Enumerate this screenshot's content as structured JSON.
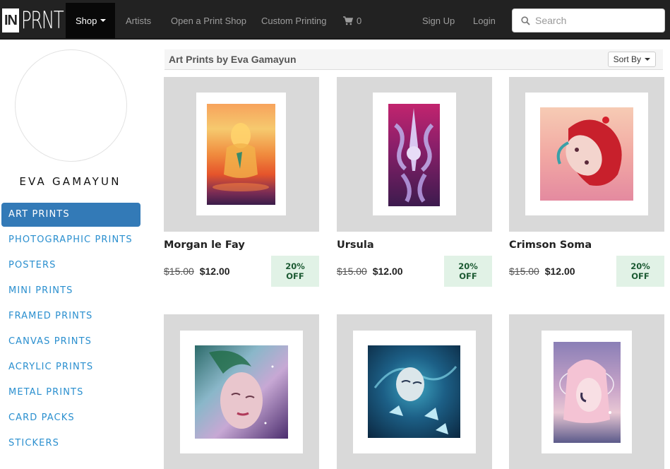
{
  "nav": {
    "logo_in": "IN",
    "logo_prnt": "PRNT",
    "shop": "Shop",
    "artists": "Artists",
    "open_shop": "Open a Print Shop",
    "custom_printing": "Custom Printing",
    "cart_count": "0",
    "sign_up": "Sign Up",
    "login": "Login",
    "search_placeholder": "Search"
  },
  "sidebar": {
    "artist_name": "EVA GAMAYUN",
    "categories": [
      {
        "label": "ART PRINTS",
        "active": true
      },
      {
        "label": "PHOTOGRAPHIC PRINTS",
        "active": false
      },
      {
        "label": "POSTERS",
        "active": false
      },
      {
        "label": "MINI PRINTS",
        "active": false
      },
      {
        "label": "FRAMED PRINTS",
        "active": false
      },
      {
        "label": "CANVAS PRINTS",
        "active": false
      },
      {
        "label": "ACRYLIC PRINTS",
        "active": false
      },
      {
        "label": "METAL PRINTS",
        "active": false
      },
      {
        "label": "CARD PACKS",
        "active": false
      },
      {
        "label": "STICKERS",
        "active": false
      }
    ]
  },
  "main": {
    "heading": "Art Prints by Eva Gamayun",
    "sort_label": "Sort By",
    "products": [
      {
        "title": "Morgan le Fay",
        "old_price": "$15.00",
        "price": "$12.00",
        "badge_line1": "20%",
        "badge_line2": "OFF"
      },
      {
        "title": "Ursula",
        "old_price": "$15.00",
        "price": "$12.00",
        "badge_line1": "20%",
        "badge_line2": "OFF"
      },
      {
        "title": "Crimson Soma",
        "old_price": "$15.00",
        "price": "$12.00",
        "badge_line1": "20%",
        "badge_line2": "OFF"
      },
      {
        "title": "",
        "old_price": "",
        "price": "",
        "badge_line1": "",
        "badge_line2": ""
      },
      {
        "title": "",
        "old_price": "",
        "price": "",
        "badge_line1": "",
        "badge_line2": ""
      },
      {
        "title": "",
        "old_price": "",
        "price": "",
        "badge_line1": "",
        "badge_line2": ""
      }
    ]
  },
  "colors": {
    "navbar": "#222222",
    "link_blue": "#2a8fcf",
    "active_blue": "#337ab7",
    "badge_bg": "#e1f2e6",
    "badge_text": "#1c5a33",
    "frame_gray": "#d9d9d9"
  }
}
